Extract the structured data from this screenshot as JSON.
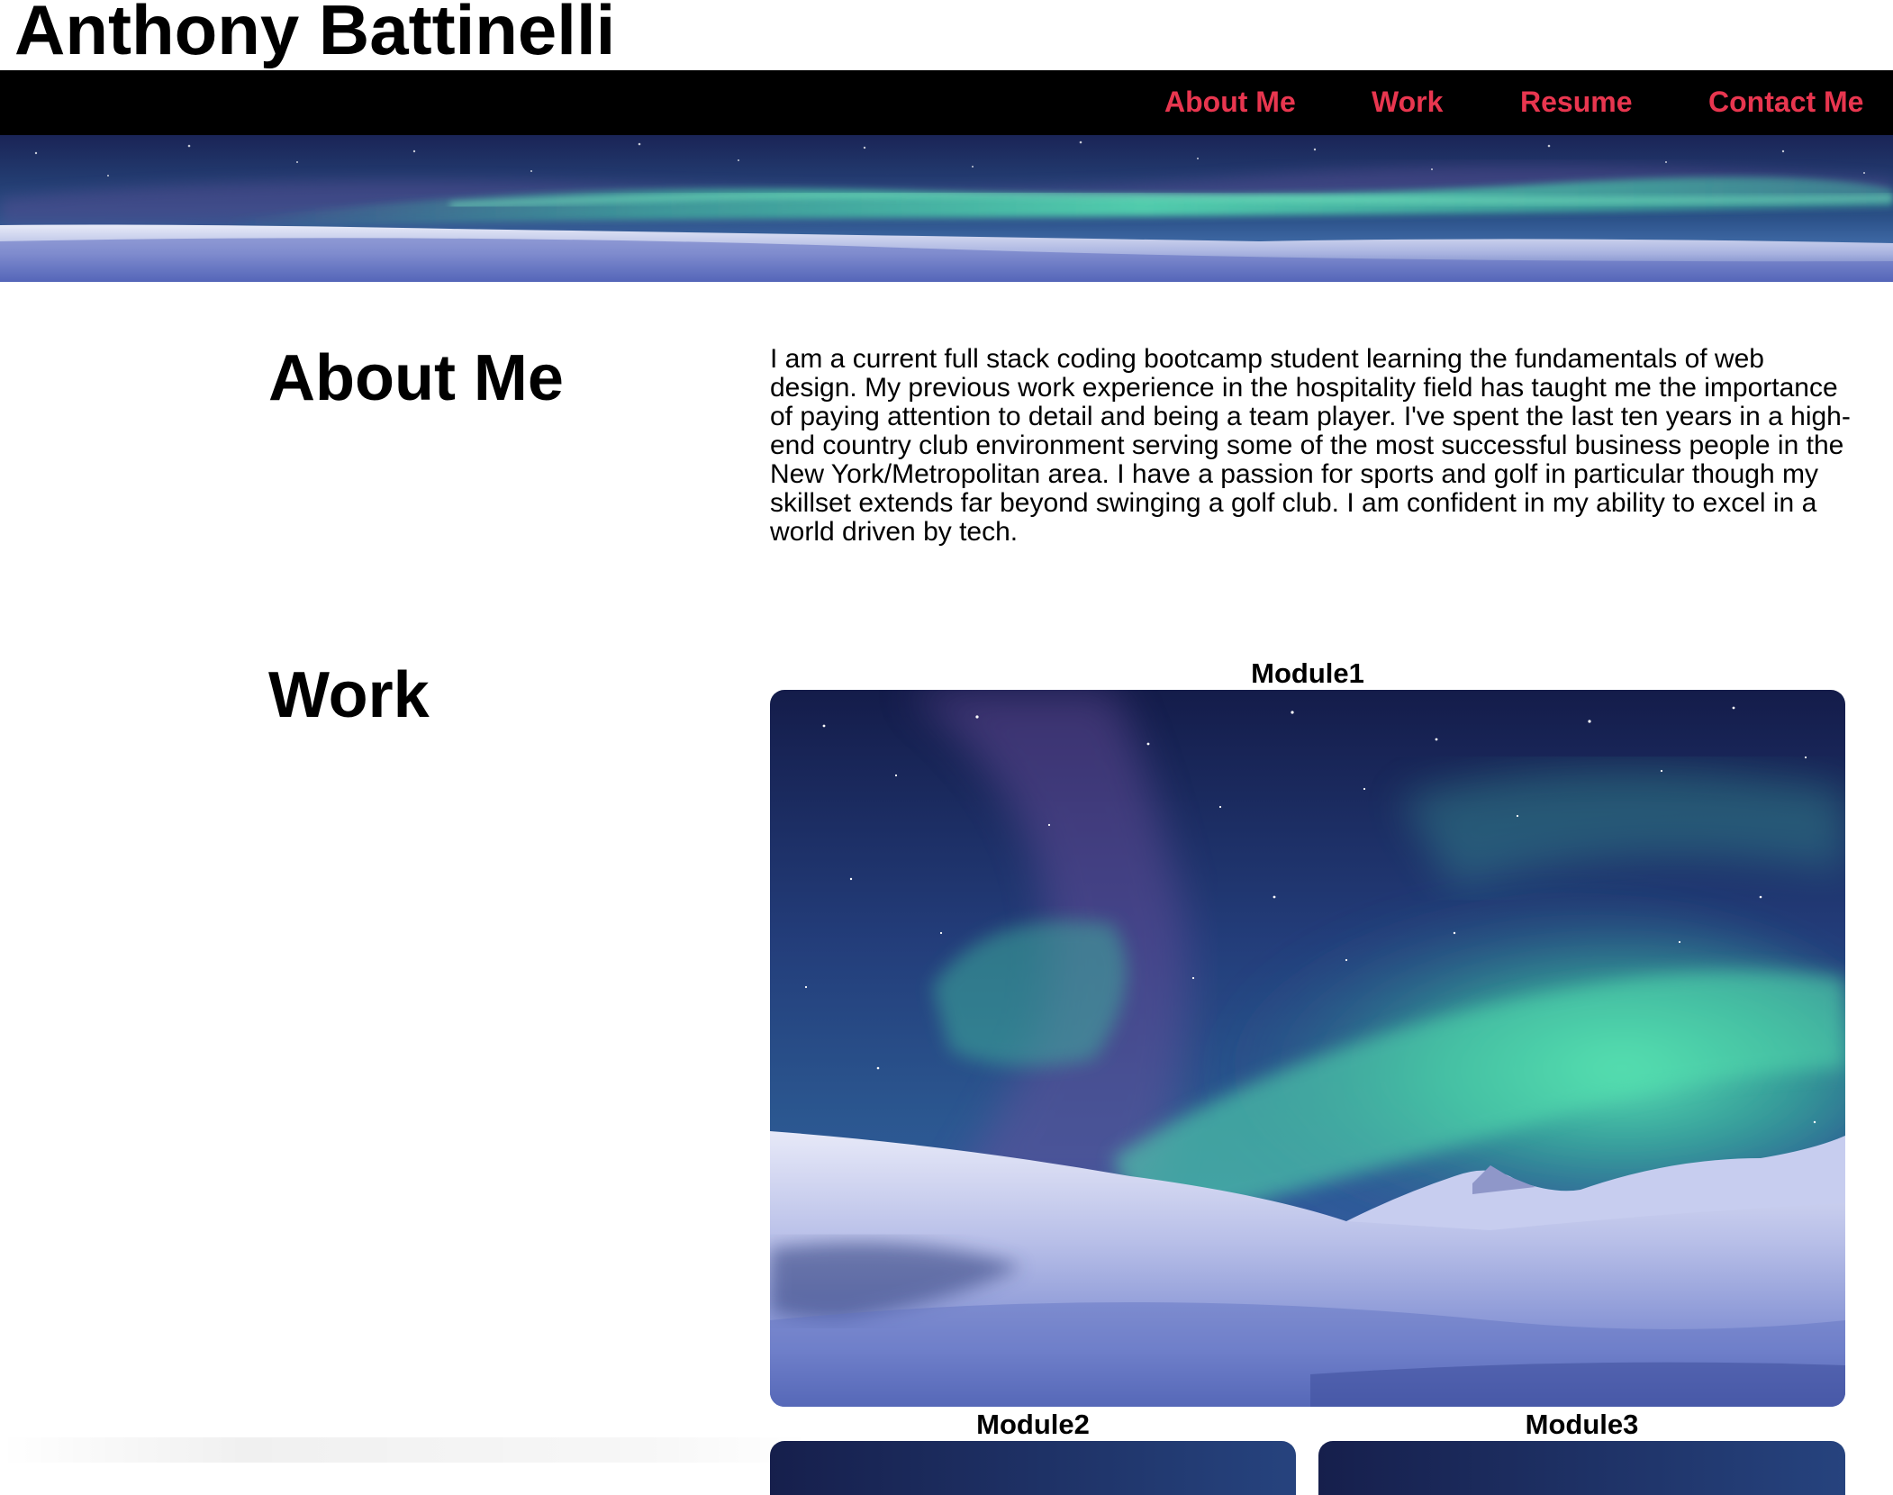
{
  "site": {
    "title": "Anthony Battinelli"
  },
  "nav": {
    "items": [
      {
        "label": "About Me"
      },
      {
        "label": "Work"
      },
      {
        "label": "Resume"
      },
      {
        "label": "Contact Me"
      }
    ],
    "link_color": "#e8364f",
    "background": "#000000"
  },
  "about": {
    "heading": "About Me",
    "text": "I am a current full stack coding bootcamp student learning the fundamentals of web design. My previous work experience in the hospitality field has taught me the importance of paying attention to detail and being a team player. I've spent the last ten years in a high-end country club environment serving some of the most successful business people in the New York/Metropolitan area. I have a passion for sports and golf in particular though my skillset extends far beyond swinging a golf club. I am confident in my ability to excel in a world driven by tech."
  },
  "work": {
    "heading": "Work",
    "modules": [
      {
        "title": "Module1"
      },
      {
        "title": "Module2"
      },
      {
        "title": "Module3"
      }
    ]
  }
}
